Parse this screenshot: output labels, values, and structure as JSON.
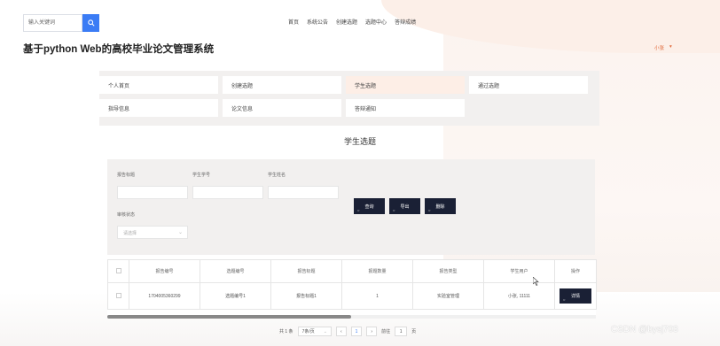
{
  "search": {
    "placeholder": "输入关键词"
  },
  "topnav": [
    "首页",
    "系统公告",
    "创建选题",
    "选题中心",
    "答辩成绩"
  ],
  "brand": {
    "title": "基于python Web的高校毕业论文管理系统"
  },
  "user": {
    "name": "小张",
    "caret": "▾"
  },
  "menu": {
    "items": [
      {
        "label": "个人首页",
        "active": false
      },
      {
        "label": "创建选题",
        "active": false
      },
      {
        "label": "学生选题",
        "active": true
      },
      {
        "label": "通过选题",
        "active": false
      },
      {
        "label": "指导信息",
        "active": false
      },
      {
        "label": "论文信息",
        "active": false
      },
      {
        "label": "答辩通知",
        "active": false
      }
    ]
  },
  "page": {
    "title": "学生选题"
  },
  "filters": {
    "title_label": "报告标题",
    "student_no_label": "学生学号",
    "student_name_label": "学生姓名",
    "status_label": "审核状态",
    "status_placeholder": "请选择",
    "query_button": "查询",
    "export_button": "导出",
    "delete_button": "删除"
  },
  "table": {
    "columns": [
      "",
      "报告编号",
      "选题编号",
      "报告标题",
      "报题数量",
      "报告类型",
      "学生用户",
      "操作"
    ],
    "rows": [
      {
        "report_no": "1704005360299",
        "topic_no": "选题编号1",
        "report_title": "报告标题1",
        "count": "1",
        "type": "实验室管理",
        "student": "小张, 11111",
        "action": "详情"
      }
    ]
  },
  "pagination": {
    "total": "共 1 条",
    "page_size": "7条/页",
    "prev": "‹",
    "current": "1",
    "next": "›",
    "goto_label": "前往",
    "goto_value": "1",
    "page_unit": "页"
  },
  "watermark": "CSDN @bysj703",
  "colors": {
    "accent": "#3b7cf5",
    "dark_button": "#1a2035",
    "active_menu": "#fdeee6",
    "user_accent": "#e06a3b"
  }
}
